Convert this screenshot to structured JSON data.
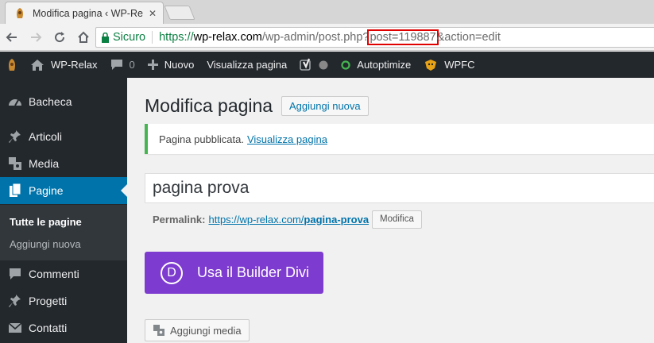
{
  "browser": {
    "tab_title": "Modifica pagina ‹ WP-Re",
    "tab_close": "✕",
    "secure_label": "Sicuro",
    "url_scheme": "https://",
    "url_host": "wp-relax.com",
    "url_path": "/wp-admin/post.php?",
    "url_highlighted": "post=119887",
    "url_tail": "&action=edit",
    "highlight_color": "#e00000"
  },
  "adminbar": {
    "site_name": "WP-Relax",
    "comments_count": "0",
    "new_label": "Nuovo",
    "view_page_label": "Visualizza pagina",
    "autoptimize_label": "Autoptimize",
    "wpfc_label": "WPFC"
  },
  "sidebar": {
    "items": [
      {
        "label": "Bacheca",
        "icon": "dashboard-icon"
      },
      {
        "label": "Articoli",
        "icon": "pin-icon"
      },
      {
        "label": "Media",
        "icon": "media-icon"
      },
      {
        "label": "Pagine",
        "icon": "pages-icon"
      },
      {
        "label": "Commenti",
        "icon": "comment-icon"
      },
      {
        "label": "Progetti",
        "icon": "pin-icon"
      },
      {
        "label": "Contatti",
        "icon": "mail-icon"
      }
    ],
    "submenu": [
      "Tutte le pagine",
      "Aggiungi nuova"
    ],
    "active_color": "#0073aa"
  },
  "main": {
    "page_title": "Modifica pagina",
    "add_new_label": "Aggiungi nuova",
    "notice_text": "Pagina pubblicata.",
    "notice_link": "Visualizza pagina",
    "post_title": "pagina prova",
    "permalink_label": "Permalink:",
    "permalink_base": "https://wp-relax.com/",
    "permalink_slug": "pagina-prova",
    "edit_label": "Modifica",
    "divi_logo_letter": "D",
    "divi_label": "Usa il Builder Divi",
    "divi_color": "#7e3bd0",
    "add_media_label": "Aggiungi media"
  }
}
